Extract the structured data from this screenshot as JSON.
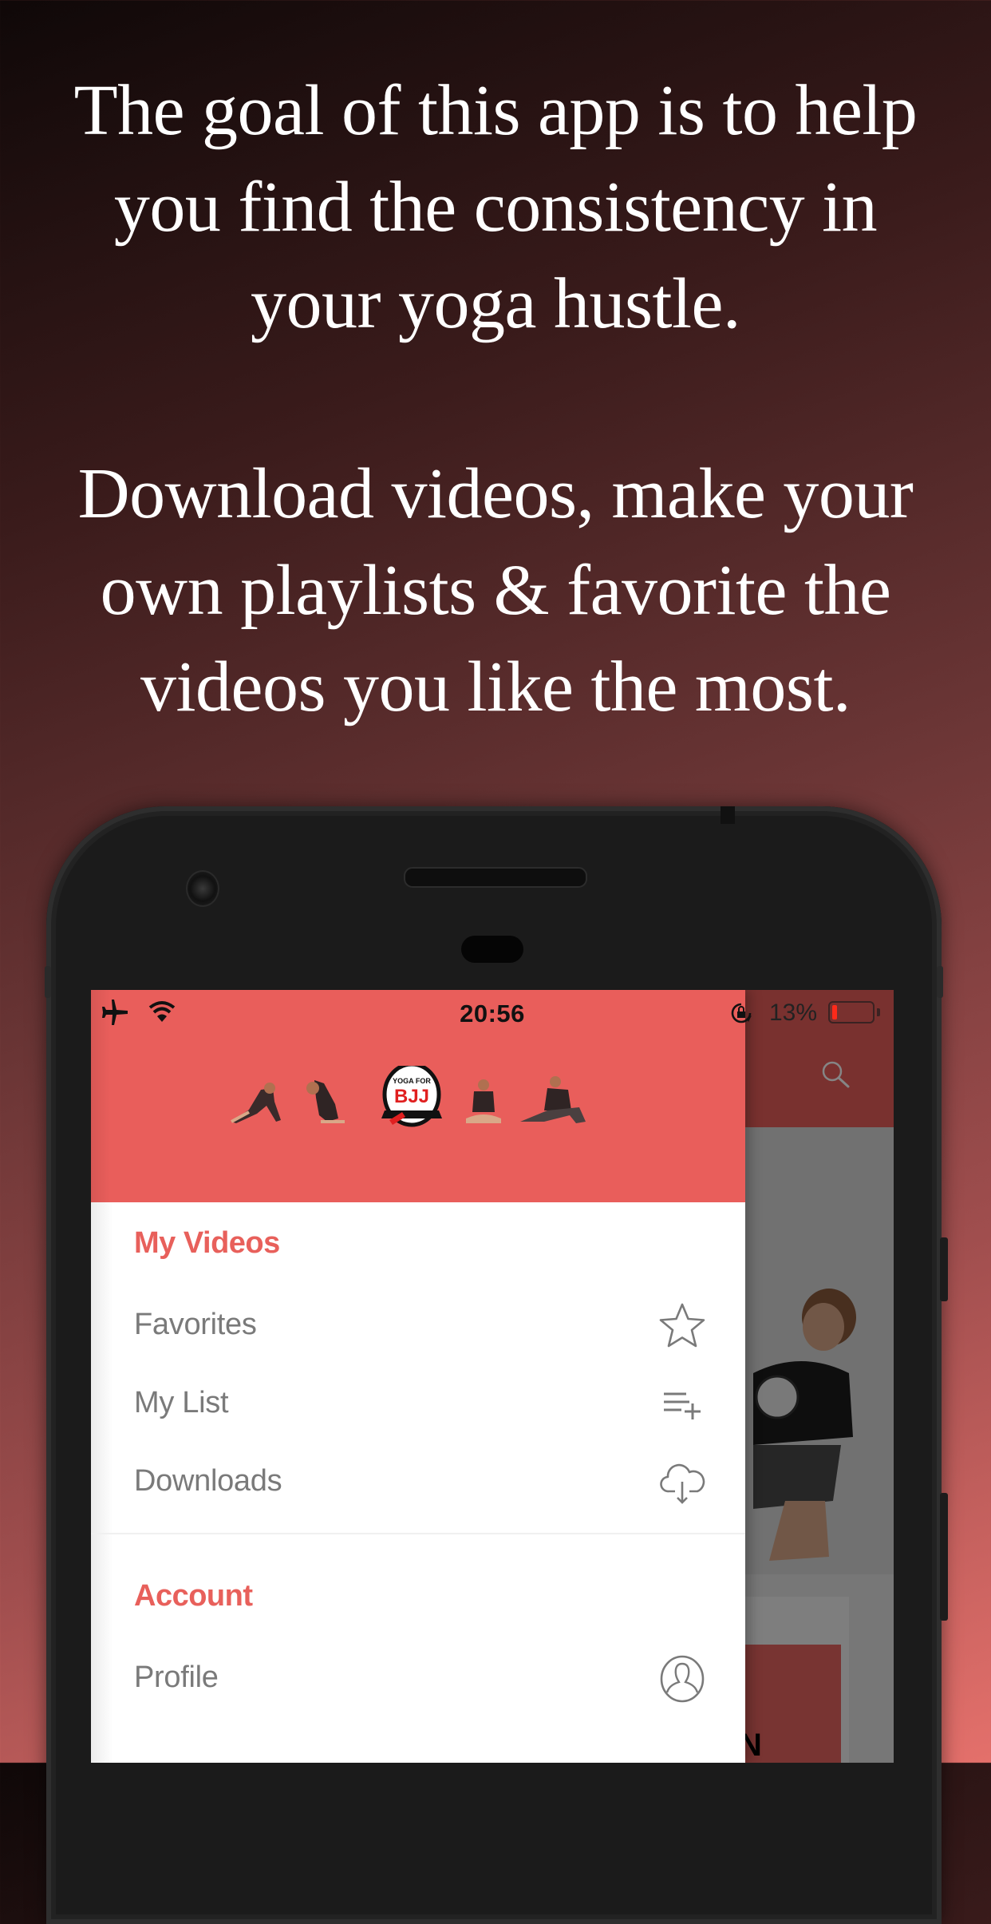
{
  "promo": {
    "lines_1": [
      "The goal of this app is to help",
      "you find the consistency in",
      "your yoga hustle."
    ],
    "lines_2": [
      "Download videos, make your",
      "own playlists & favorite the",
      "videos you like the most."
    ]
  },
  "status_bar": {
    "time": "20:56",
    "battery_percent_label": "13%",
    "battery_level": 0.13,
    "icons": [
      "airplane-mode-icon",
      "wifi-icon",
      "rotation-lock-icon",
      "battery-icon"
    ]
  },
  "app": {
    "logo_text_top": "YOGA FOR",
    "logo_text_main": "BJJ",
    "brand_color": "#e95e5b",
    "underlying_card_text": "N"
  },
  "drawer": {
    "sections": [
      {
        "title": "My Videos",
        "items": [
          {
            "label": "Favorites",
            "icon": "star-icon"
          },
          {
            "label": "My List",
            "icon": "playlist-add-icon"
          },
          {
            "label": "Downloads",
            "icon": "cloud-download-icon"
          }
        ]
      },
      {
        "title": "Account",
        "items": [
          {
            "label": "Profile",
            "icon": "profile-icon"
          }
        ]
      }
    ]
  }
}
